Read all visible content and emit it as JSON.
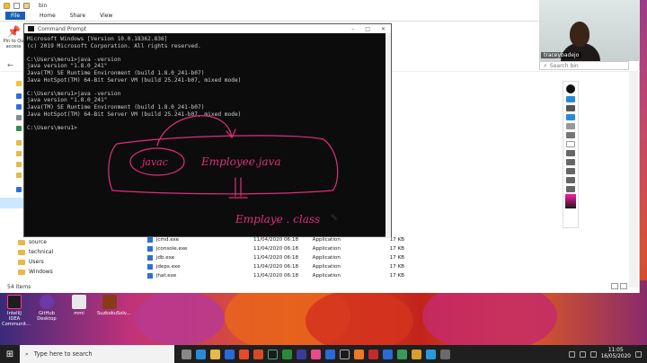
{
  "explorer": {
    "path_title": "bin",
    "ribbon_tabs": [
      "File",
      "Home",
      "Share",
      "View"
    ],
    "pin_label_1": "Pin to Qu",
    "pin_label_2": "access",
    "search_placeholder": "Search bin",
    "nav_folders": [
      "source",
      "technical",
      "Users",
      "Windows"
    ],
    "item_count": "54 items",
    "files": [
      {
        "name": "jcmd.exe",
        "date": "11/04/2020 06:18",
        "type": "Application",
        "size": "17 KB"
      },
      {
        "name": "jconsole.exe",
        "date": "11/04/2020 06:18",
        "type": "Application",
        "size": "17 KB"
      },
      {
        "name": "jdb.exe",
        "date": "11/04/2020 06:18",
        "type": "Application",
        "size": "17 KB"
      },
      {
        "name": "jdeps.exe",
        "date": "11/04/2020 06:18",
        "type": "Application",
        "size": "17 KB"
      },
      {
        "name": "jhat.exe",
        "date": "11/04/2020 06:18",
        "type": "Application",
        "size": "17 KB"
      }
    ]
  },
  "webcam": {
    "name": "traceybadejo"
  },
  "cmd": {
    "title": "Command Prompt",
    "lines": [
      "Microsoft Windows [Version 10.0.18362.836]",
      "(c) 2019 Microsoft Corporation. All rights reserved.",
      "",
      "C:\\Users\\meru1>java -version",
      "java version \"1.8.0_241\"",
      "Java(TM) SE Runtime Environment (build 1.8.0_241-b07)",
      "Java HotSpot(TM) 64-Bit Server VM (build 25.241-b07, mixed mode)",
      "",
      "C:\\Users\\meru1>java -version",
      "java version \"1.8.0_241\"",
      "Java(TM) SE Runtime Environment (build 1.8.0_241-b07)",
      "Java HotSpot(TM) 64-Bit Server VM (build 25.241-b07, mixed mode)",
      "",
      "C:\\Users\\meru1>"
    ]
  },
  "ink": {
    "color": "#e0307a",
    "word_javac": "javac",
    "word_source": "Employee.java",
    "word_output": "Emplaye . class"
  },
  "desktop_icons": [
    {
      "label_1": "IntelliJ IDEA",
      "label_2": "Communit...",
      "color": "#1e1e1e"
    },
    {
      "label_1": "GitHub",
      "label_2": "Desktop",
      "color": "#6b3aa8"
    },
    {
      "label_1": "mmi",
      "label_2": "",
      "color": "#e8e8e8"
    },
    {
      "label_1": "SuzbokuSolv...",
      "label_2": "",
      "color": "#8a3a1a"
    }
  ],
  "taskbar": {
    "search_placeholder": "Type here to search",
    "time": "11:05",
    "date": "16/05/2020"
  }
}
